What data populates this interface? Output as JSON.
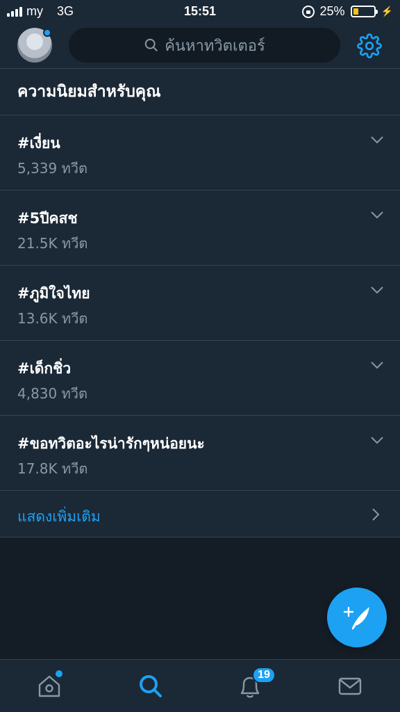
{
  "status_bar": {
    "carrier": "my",
    "network": "3G",
    "time": "15:51",
    "battery": "25%",
    "battery_level": 0.25
  },
  "header": {
    "search_placeholder": "ค้นหาทวิตเตอร์"
  },
  "section": {
    "title": "ความนิยมสำหรับคุณ"
  },
  "trends": [
    {
      "name": "#เงี่ยน",
      "count": "5,339 ทวีต"
    },
    {
      "name": "#5ปีคสช",
      "count": "21.5K ทวีต"
    },
    {
      "name": "#ภูมิใจไทย",
      "count": "13.6K ทวีต"
    },
    {
      "name": "#เด็กชิ่ว",
      "count": "4,830 ทวีต"
    },
    {
      "name": "#ขอทวิตอะไรน่ารักๆหน่อยนะ",
      "count": "17.8K ทวีต"
    }
  ],
  "show_more": "แสดงเพิ่มเติม",
  "tabbar": {
    "notifications_badge": "19"
  },
  "colors": {
    "accent": "#1da1f2",
    "background": "#141d26",
    "panel": "#1b2836",
    "muted_text": "#8899a6",
    "battery_fill": "#f5c518"
  },
  "icons": {
    "search": "search-icon",
    "settings": "gear-icon",
    "chevron": "chevron-down-icon",
    "more": "chevron-right-icon",
    "compose": "compose-tweet-icon",
    "home": "home-icon",
    "explore": "explore-search-icon",
    "notifications": "bell-icon",
    "messages": "mail-icon"
  }
}
